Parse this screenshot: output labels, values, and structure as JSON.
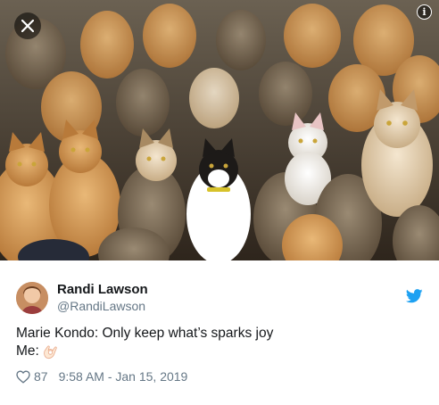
{
  "photo": {
    "alt_icons": {
      "close": "close-icon",
      "info": "info-icon"
    },
    "info_label": "i"
  },
  "author": {
    "display_name": "Randi Lawson",
    "handle": "@RandiLawson",
    "platform_icon": "twitter-bird-icon"
  },
  "tweet": {
    "line1": "Marie Kondo: Only keep what’s sparks joy",
    "line2": "Me:",
    "emoji_icon": "ok-hand-emoji-icon"
  },
  "meta": {
    "like_count": "87",
    "timestamp": "9:58 AM - Jan 15, 2019"
  },
  "colors": {
    "text": "#14171a",
    "muted": "#657786",
    "twitter_blue": "#1da1f2"
  }
}
